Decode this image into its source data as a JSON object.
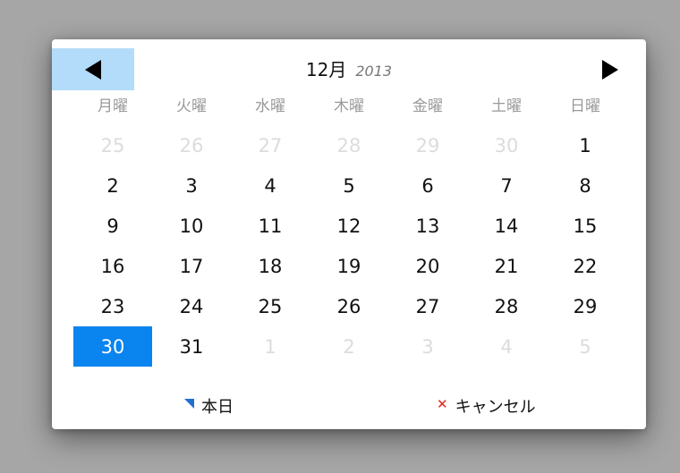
{
  "header": {
    "month": "12月",
    "year": "2013"
  },
  "weekdays": [
    "月曜",
    "火曜",
    "水曜",
    "木曜",
    "金曜",
    "土曜",
    "日曜"
  ],
  "weeks": [
    [
      {
        "d": "25",
        "other": true
      },
      {
        "d": "26",
        "other": true
      },
      {
        "d": "27",
        "other": true
      },
      {
        "d": "28",
        "other": true
      },
      {
        "d": "29",
        "other": true
      },
      {
        "d": "30",
        "other": true
      },
      {
        "d": "1"
      }
    ],
    [
      {
        "d": "2"
      },
      {
        "d": "3"
      },
      {
        "d": "4"
      },
      {
        "d": "5"
      },
      {
        "d": "6"
      },
      {
        "d": "7"
      },
      {
        "d": "8"
      }
    ],
    [
      {
        "d": "9"
      },
      {
        "d": "10"
      },
      {
        "d": "11"
      },
      {
        "d": "12"
      },
      {
        "d": "13"
      },
      {
        "d": "14"
      },
      {
        "d": "15"
      }
    ],
    [
      {
        "d": "16"
      },
      {
        "d": "17"
      },
      {
        "d": "18"
      },
      {
        "d": "19"
      },
      {
        "d": "20"
      },
      {
        "d": "21"
      },
      {
        "d": "22"
      }
    ],
    [
      {
        "d": "23"
      },
      {
        "d": "24"
      },
      {
        "d": "25"
      },
      {
        "d": "26"
      },
      {
        "d": "27"
      },
      {
        "d": "28"
      },
      {
        "d": "29"
      }
    ],
    [
      {
        "d": "30",
        "selected": true
      },
      {
        "d": "31"
      },
      {
        "d": "1",
        "other": true
      },
      {
        "d": "2",
        "other": true
      },
      {
        "d": "3",
        "other": true
      },
      {
        "d": "4",
        "other": true
      },
      {
        "d": "5",
        "other": true
      }
    ]
  ],
  "footer": {
    "today_label": "本日",
    "cancel_label": "キャンセル"
  },
  "icons": {
    "prev": "triangle-left-icon",
    "next": "triangle-right-icon",
    "today": "corner-triangle-icon",
    "cancel": "x-mark-icon"
  },
  "colors": {
    "selected_bg": "#0a84ee",
    "prev_button_bg": "#b3dcfa",
    "today_icon": "#1f6fd1",
    "cancel_icon": "#e2241b"
  }
}
